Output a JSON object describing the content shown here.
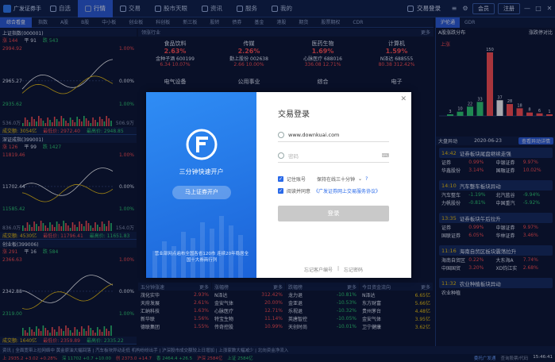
{
  "app": {
    "name": "广发证券手",
    "window_buttons": [
      "—",
      "□",
      "✕"
    ]
  },
  "nav": {
    "items": [
      {
        "label": "自选",
        "icon": "star-icon",
        "active": false
      },
      {
        "label": "行情",
        "icon": "chart-icon",
        "active": true
      },
      {
        "label": "交易",
        "icon": "swap-icon",
        "active": false
      },
      {
        "label": "股市天眼",
        "icon": "eye-icon",
        "active": false
      },
      {
        "label": "资讯",
        "icon": "news-icon",
        "active": false
      },
      {
        "label": "服务",
        "icon": "service-icon",
        "active": false
      },
      {
        "label": "我的",
        "icon": "user-icon",
        "active": false
      }
    ],
    "trade_login": "交易登录",
    "btn_member": "会员",
    "btn_register": "注册"
  },
  "subtabs": [
    "综合看盘",
    "指数",
    "A股",
    "B股",
    "中小板",
    "创业板",
    "科创板",
    "新三板",
    "股转",
    "债券",
    "基金",
    "港股",
    "期货",
    "股票期权",
    "CDR"
  ],
  "right_tabs": [
    "沪伦通",
    "GDR"
  ],
  "panels": [
    {
      "title": "上证指数(000001)",
      "sub": [
        "涨 144",
        "平 91",
        "跌 543"
      ],
      "left_top": "2994.92",
      "left_mid": "2965.27",
      "left_bot": "2935.62",
      "right_top": "1.00%",
      "right_mid": "0.00%",
      "right_bot": "1.00%",
      "vol_l": "536.0万",
      "vol_r": "506.9万",
      "foot": [
        "成交额: 3054亿",
        "最低价: 2972.40",
        "最高价: 2948.85"
      ]
    },
    {
      "title": "深证成指(399001)",
      "sub": [
        "涨 126",
        "平 99",
        "跌 1427"
      ],
      "left_top": "11819.46",
      "left_mid": "11702.44",
      "left_bot": "11585.42",
      "right_top": "1.00%",
      "right_mid": "0.00%",
      "right_bot": "1.00%",
      "vol_l": "836.0万",
      "vol_r": "154.0万",
      "foot": [
        "成交额: 4530亿",
        "最低价: 11796.41",
        "最高价: 11651.83"
      ]
    },
    {
      "title": "创业板(399006)",
      "sub": [
        "涨 291",
        "平 16",
        "跌 584"
      ],
      "left_top": "2366.63",
      "left_mid": "2342.88",
      "left_bot": "2319.00",
      "right_top": "1.00%",
      "right_mid": "0.00%",
      "right_bot": "1.00%",
      "vol_l": "",
      "vol_r": "",
      "foot": [
        "成交额: 1640亿",
        "最低价: 2359.89",
        "最高价: 2335.22"
      ]
    }
  ],
  "sector": {
    "head_left": "领涨行业",
    "head_right": "更多",
    "cards": [
      {
        "name": "食品饮料",
        "pct": "2.63%",
        "lead": "金种子酒 600199",
        "lead_val": "6.34 10.07%",
        "color": "red"
      },
      {
        "name": "传媒",
        "pct": "2.26%",
        "lead": "勤上股份 002638",
        "lead_val": "2.66 10.00%",
        "color": "red"
      },
      {
        "name": "医药生物",
        "pct": "1.69%",
        "lead": "心脉医疗 688016",
        "lead_val": "336.08 12.71%",
        "color": "red"
      },
      {
        "name": "计算机",
        "pct": "1.59%",
        "lead": "N泽达 688555",
        "lead_val": "80.38 312.42%",
        "color": "red"
      },
      {
        "name": "电气设备",
        "pct": "",
        "lead": "",
        "lead_val": "",
        "color": "red"
      },
      {
        "name": "公用事业",
        "pct": "",
        "lead": "",
        "lead_val": "",
        "color": "red"
      },
      {
        "name": "综合",
        "pct": "",
        "lead": "",
        "lead_val": "",
        "color": "red"
      },
      {
        "name": "电子",
        "pct": "",
        "lead": "",
        "lead_val": "",
        "color": "red"
      }
    ]
  },
  "right": {
    "head_left": "A股涨跌分布",
    "head_right": "涨跌停对比",
    "dist_values": [
      3,
      10,
      22,
      33,
      150,
      37,
      28,
      18,
      8,
      6,
      1
    ],
    "up_label": "上涨",
    "events_head": "大盘异动",
    "events_date": "2020-06-23",
    "events_btn": "查看异动详情",
    "events": [
      {
        "time": "14:42",
        "title": "证券板块尾盘继续走强",
        "rows": [
          [
            "证券",
            "0.99%",
            "中银证券",
            "9.97%"
          ],
          [
            "华鑫股份",
            "3.14%",
            "国融证券",
            "10.02%"
          ]
        ]
      },
      {
        "time": "14:10",
        "title": "汽车整车板块异动",
        "rows": [
          [
            "汽车整车",
            "-1.19%",
            "北汽蓝谷",
            "-9.94%"
          ],
          [
            "力帆股份",
            "-0.81%",
            "中国重汽",
            "-5.92%"
          ]
        ]
      },
      {
        "time": "13:35",
        "title": "证券板块午后拉升",
        "rows": [
          [
            "证券",
            "0.99%",
            "中银证券",
            "9.97%"
          ],
          [
            "国联证券",
            "6.05%",
            "华林证券",
            "3.46%"
          ]
        ]
      },
      {
        "time": "11:16",
        "title": "海南自贸区板块震荡拉升",
        "rows": [
          [
            "海南自贸区",
            "0.22%",
            "大东海A",
            "7.74%"
          ],
          [
            "中国国贸",
            "3.20%",
            "XD钧江实",
            "2.68%"
          ]
        ]
      },
      {
        "time": "11:32",
        "title": "农业种植板块异动",
        "rows": [
          [
            "农业种植",
            "",
            "",
            ""
          ]
        ]
      }
    ]
  },
  "tables": [
    {
      "head": "五分钟涨速",
      "more": "更多",
      "rows": [
        [
          "茂化实华",
          "2.93%"
        ],
        [
          "天府发展",
          "2.61%"
        ],
        [
          "汇纳科技",
          "1.63%"
        ],
        [
          "新华联",
          "1.56%"
        ],
        [
          "德联集团",
          "1.55%"
        ]
      ]
    },
    {
      "head": "涨幅榜",
      "more": "更多",
      "rows": [
        [
          "N泽达",
          "312.42%"
        ],
        [
          "金安气体",
          "20.00%"
        ],
        [
          "心脉医疗",
          "12.71%"
        ],
        [
          "特宝生物",
          "11.14%"
        ],
        [
          "传奇控股",
          "10.99%"
        ]
      ]
    },
    {
      "head": "跌幅榜",
      "more": "更多",
      "rows": [
        [
          "龙力退",
          "-10.81%"
        ],
        [
          "金亚退",
          "-10.53%"
        ],
        [
          "乐视退",
          "-10.32%"
        ],
        [
          "英唐智控",
          "-10.05%"
        ],
        [
          "天创时尚",
          "-10.01%"
        ]
      ]
    },
    {
      "head": "今日资金流向",
      "more": "更多",
      "rows": [
        [
          "N泽达",
          "6.65亿"
        ],
        [
          "东方财富",
          "5.66亿"
        ],
        [
          "贵州茅台",
          "4.48亿"
        ],
        [
          "金安气体",
          "3.95亿"
        ],
        [
          "卫宁健康",
          "3.62亿"
        ]
      ]
    }
  ],
  "ticker": {
    "text": "资讯 | 全面宽带上拉网络中 黄金原油大幅回落 | 汽车板块异动走低 机构纷纷出手 | 沪深股市成交额较上日增加 | 上涨家数大幅减少 | 北向资金净流入"
  },
  "status": {
    "items": [
      "上 2935.2 +3.02 +0.28%",
      "深 11702 +0.7 +10.00",
      "创 2373.0 +14.7",
      "香 2464.4 +26.5",
      "沪深 2584亿",
      "上证 2584亿"
    ],
    "right": [
      "委托广发通",
      "查询股票/代码",
      "15:46:41"
    ]
  },
  "dialog": {
    "slogan": "三分钟快速开户",
    "open_button": "马上证券开户",
    "note": "营业部网点遍布全国各省120市 连续20年稳居全国十大券商行列",
    "title": "交易登录",
    "account_value": "www.downkuai.com",
    "password_placeholder": "密码",
    "remember_label": "记住账号",
    "keep_label": "保持在线三十分钟",
    "agree_prefix": "阅读并同意",
    "agree_link": "《广发证券网上交易服务协议》",
    "login_button": "登录",
    "link_account": "忘记客户编号",
    "link_password": "忘记密码",
    "close_label": "✕"
  }
}
